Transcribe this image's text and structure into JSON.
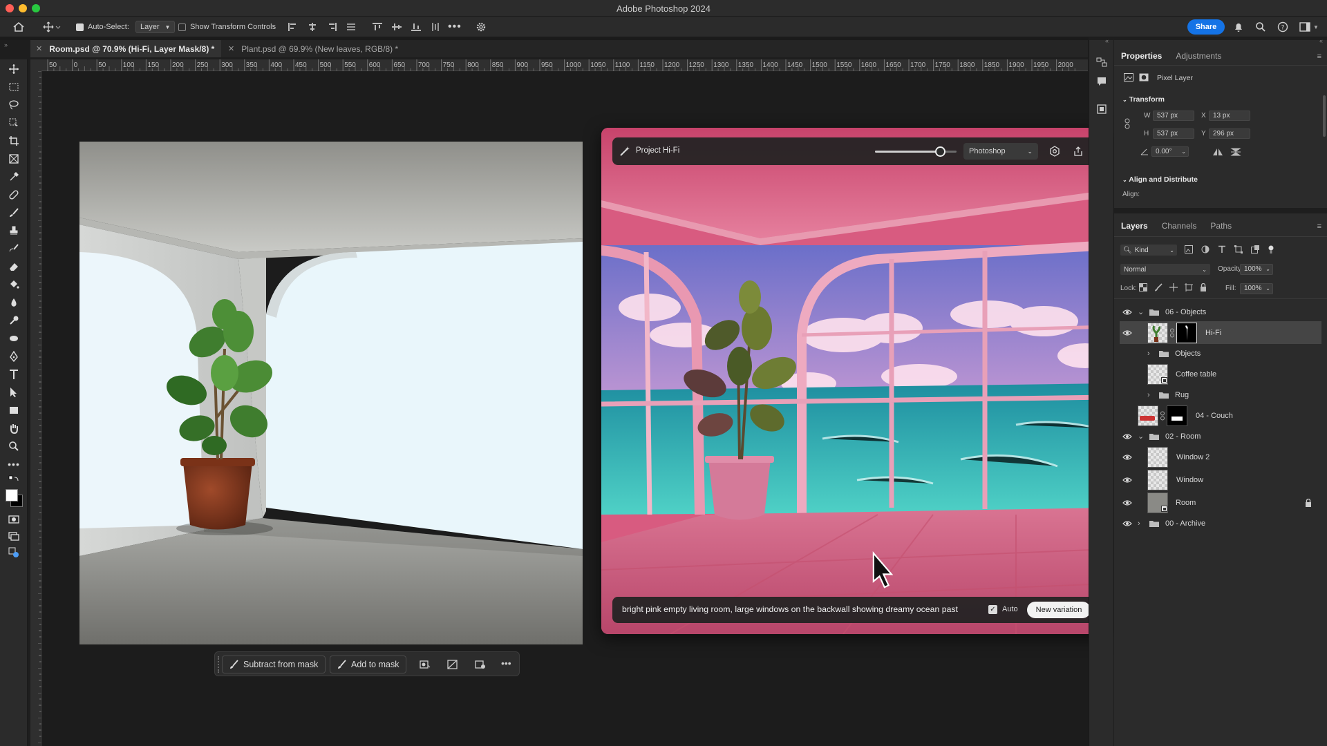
{
  "app_title": "Adobe Photoshop 2024",
  "options_bar": {
    "auto_select_label": "Auto-Select:",
    "auto_select_value": "Layer",
    "transform_controls_label": "Show Transform Controls",
    "share_label": "Share"
  },
  "tabs": [
    {
      "label": "Room.psd @ 70.9% (Hi-Fi, Layer Mask/8) *",
      "active": true
    },
    {
      "label": "Plant.psd @ 69.9% (New leaves, RGB/8) *",
      "active": false
    }
  ],
  "ruler_ticks": [
    "50",
    "0",
    "50",
    "100",
    "150",
    "200",
    "250",
    "300",
    "350",
    "400",
    "450",
    "500",
    "550",
    "600",
    "650",
    "700",
    "750",
    "800",
    "850",
    "900",
    "950",
    "1000",
    "1050",
    "1100",
    "1150",
    "1200",
    "1250",
    "1300",
    "1350",
    "1400",
    "1450",
    "1500",
    "1550",
    "1600",
    "1650",
    "1700",
    "1750",
    "1800",
    "1850",
    "1900",
    "1950",
    "2000"
  ],
  "hifi": {
    "title": "Project Hi-Fi",
    "slider_value": 0.8,
    "app_select": "Photoshop",
    "prompt": "bright pink empty living room, large windows on the backwall showing dreamy ocean past",
    "auto_label": "Auto",
    "auto_checked": true,
    "new_variation_label": "New variation"
  },
  "mask_toolbar": {
    "subtract_label": "Subtract from mask",
    "add_label": "Add to mask"
  },
  "properties": {
    "tabs": [
      "Properties",
      "Adjustments"
    ],
    "layer_type": "Pixel Layer",
    "transform_title": "Transform",
    "w_label": "W",
    "w": "537 px",
    "h_label": "H",
    "h": "537 px",
    "x_label": "X",
    "x": "13 px",
    "y_label": "Y",
    "y": "296 px",
    "angle": "0.00°",
    "align_title": "Align and Distribute",
    "align_label": "Align:"
  },
  "layers_panel": {
    "tabs": [
      "Layers",
      "Channels",
      "Paths"
    ],
    "kind": "Kind",
    "blend_mode": "Normal",
    "opacity_label": "Opacity:",
    "opacity": "100%",
    "lock_label": "Lock:",
    "fill_label": "Fill:",
    "fill": "100%",
    "layers": [
      {
        "name": "06 - Objects",
        "type": "group",
        "open": true,
        "visible": true
      },
      {
        "name": "Hi-Fi",
        "type": "masked",
        "visible": true,
        "selected": true
      },
      {
        "name": "Objects",
        "type": "group",
        "open": false,
        "visible": false
      },
      {
        "name": "Coffee table",
        "type": "smart",
        "visible": false
      },
      {
        "name": "Rug",
        "type": "group",
        "open": false,
        "visible": false
      },
      {
        "name": "04 - Couch",
        "type": "masked-couch",
        "visible": false
      },
      {
        "name": "02 - Room",
        "type": "group",
        "open": true,
        "visible": true
      },
      {
        "name": "Window 2",
        "type": "pixel",
        "visible": true
      },
      {
        "name": "Window",
        "type": "pixel",
        "visible": true
      },
      {
        "name": "Room",
        "type": "smart-room",
        "visible": true,
        "locked": true
      },
      {
        "name": "00 - Archive",
        "type": "group",
        "open": false,
        "visible": true
      }
    ]
  },
  "colors": {
    "accent": "#1473e6",
    "panel": "#2b2b2b",
    "canvas": "#1c1c1c"
  }
}
